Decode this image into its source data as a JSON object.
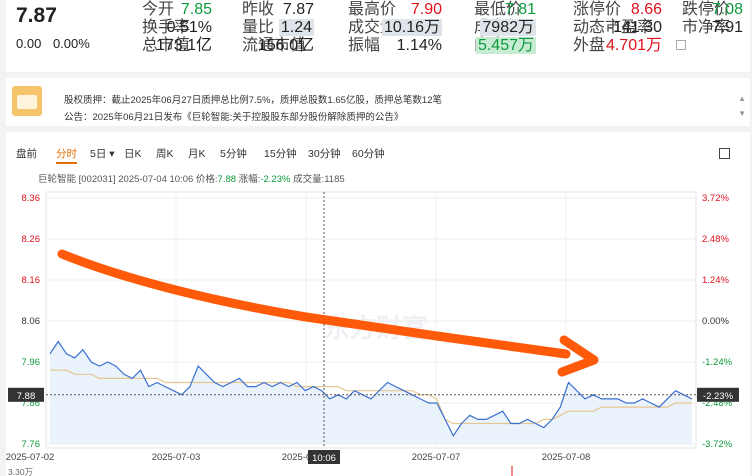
{
  "quote": {
    "price": "7.87",
    "change": "0.00",
    "change_pct": "0.00%",
    "fields": [
      {
        "label": "今开",
        "value": "7.85",
        "color": "green"
      },
      {
        "label": "昨收",
        "value": "7.87",
        "color": "dark"
      },
      {
        "label": "最高价",
        "value": "7.90",
        "color": "red"
      },
      {
        "label": "最低价",
        "value": "7.81",
        "color": "green"
      },
      {
        "label": "涨停价",
        "value": "8.66",
        "color": "red"
      },
      {
        "label": "跌停价",
        "value": "7.08",
        "color": "green"
      },
      {
        "label": "换手率",
        "value": "0.51%",
        "color": "dark"
      },
      {
        "label": "量比",
        "value": "1.24",
        "color": "dark",
        "hl": true
      },
      {
        "label": "成交量",
        "value": "10.16万",
        "color": "dark",
        "hl": true
      },
      {
        "label": "成交额",
        "value": "7982万",
        "color": "dark",
        "hl": true
      },
      {
        "label": "动态市盈率",
        "value": "-141.30",
        "color": "dark"
      },
      {
        "label": "市净率",
        "value": "7.91",
        "color": "dark"
      },
      {
        "label": "总市值",
        "value": "173.1亿",
        "color": "dark"
      },
      {
        "label": "流通市值",
        "value": "156.0亿",
        "color": "dark"
      },
      {
        "label": "振幅",
        "value": "1.14%",
        "color": "dark"
      },
      {
        "label": "内盘",
        "value": "5.457万",
        "color": "green",
        "hlg": true
      },
      {
        "label": "外盘",
        "value": "4.701万",
        "color": "red"
      }
    ]
  },
  "notice": {
    "line1": "股权质押：截止2025年06月27日质押总比例7.5%，质押总股数1.65亿股，质押总笔数12笔",
    "line2": "公告：2025年06月21日发布《巨轮智能:关于控股股东部分股份解除质押的公告》",
    "scroll_up": "▲",
    "scroll_down": "▼"
  },
  "chart_tabs": [
    "盘前",
    "分时",
    "5日",
    "日K",
    "周K",
    "月K",
    "5分钟",
    "15分钟",
    "30分钟",
    "60分钟"
  ],
  "active_tab": "分时",
  "five_day_caret": "▾",
  "info": {
    "prefix": "巨轮智能 [002031]  2025-07-04 10:06  价格:",
    "price": "7.88",
    "mid": "  涨幅:",
    "change": "-2.23%",
    "suffix": "  成交量:1185"
  },
  "watermark": "东方财富",
  "bottom_label": "3.30万",
  "chart_data": {
    "type": "line",
    "title": "巨轮智能 [002031]",
    "y_ticks": [
      8.36,
      8.26,
      8.16,
      8.06,
      7.96,
      7.86,
      7.76
    ],
    "pct_ticks": [
      "3.72%",
      "2.48%",
      "1.24%",
      "0.00%",
      "-1.24%",
      "-2.48%",
      "-3.72%"
    ],
    "x_ticks": [
      "2025-07-02",
      "2025-07-03",
      "2025-07-04",
      "2025-07-07",
      "2025-07-08"
    ],
    "ylim": [
      7.76,
      8.36
    ],
    "crosshair": {
      "date": "10:06",
      "price": "7.88",
      "pct": "-2.23%"
    },
    "price_series": [
      7.98,
      8.01,
      7.98,
      7.97,
      7.99,
      7.96,
      7.95,
      7.96,
      7.95,
      7.93,
      7.92,
      7.94,
      7.9,
      7.91,
      7.9,
      7.89,
      7.88,
      7.9,
      7.95,
      7.93,
      7.91,
      7.9,
      7.91,
      7.92,
      7.9,
      7.9,
      7.91,
      7.9,
      7.91,
      7.9,
      7.91,
      7.89,
      7.9,
      7.89,
      7.87,
      7.88,
      7.87,
      7.89,
      7.88,
      7.87,
      7.89,
      7.91,
      7.9,
      7.89,
      7.88,
      7.87,
      7.86,
      7.86,
      7.82,
      7.78,
      7.81,
      7.83,
      7.82,
      7.82,
      7.83,
      7.84,
      7.81,
      7.81,
      7.82,
      7.81,
      7.8,
      7.82,
      7.85,
      7.91,
      7.89,
      7.87,
      7.88,
      7.87,
      7.87,
      7.87,
      7.86,
      7.86,
      7.87,
      7.86,
      7.85,
      7.87,
      7.89,
      7.88,
      7.87
    ],
    "avg_series": [
      7.94,
      7.94,
      7.94,
      7.93,
      7.93,
      7.93,
      7.92,
      7.92,
      7.92,
      7.92,
      7.92,
      7.92,
      7.92,
      7.92,
      7.91,
      7.91,
      7.91,
      7.91,
      7.91,
      7.91,
      7.91,
      7.91,
      7.91,
      7.91,
      7.91,
      7.91,
      7.91,
      7.91,
      7.91,
      7.91,
      7.9,
      7.9,
      7.9,
      7.9,
      7.9,
      7.9,
      7.89,
      7.89,
      7.89,
      7.89,
      7.89,
      7.89,
      7.89,
      7.89,
      7.89,
      7.88,
      7.88,
      7.87,
      7.82,
      7.81,
      7.81,
      7.81,
      7.81,
      7.81,
      7.81,
      7.81,
      7.81,
      7.81,
      7.81,
      7.81,
      7.82,
      7.82,
      7.83,
      7.84,
      7.84,
      7.84,
      7.84,
      7.85,
      7.85,
      7.85,
      7.85,
      7.85,
      7.85,
      7.85,
      7.85,
      7.85,
      7.86,
      7.86,
      7.86
    ]
  },
  "colors": {
    "red": "#e0101e",
    "green": "#0c9a3c",
    "price_line": "#3a6fd0",
    "avg_line": "#e6c690",
    "annotation": "#ff5a0a"
  }
}
